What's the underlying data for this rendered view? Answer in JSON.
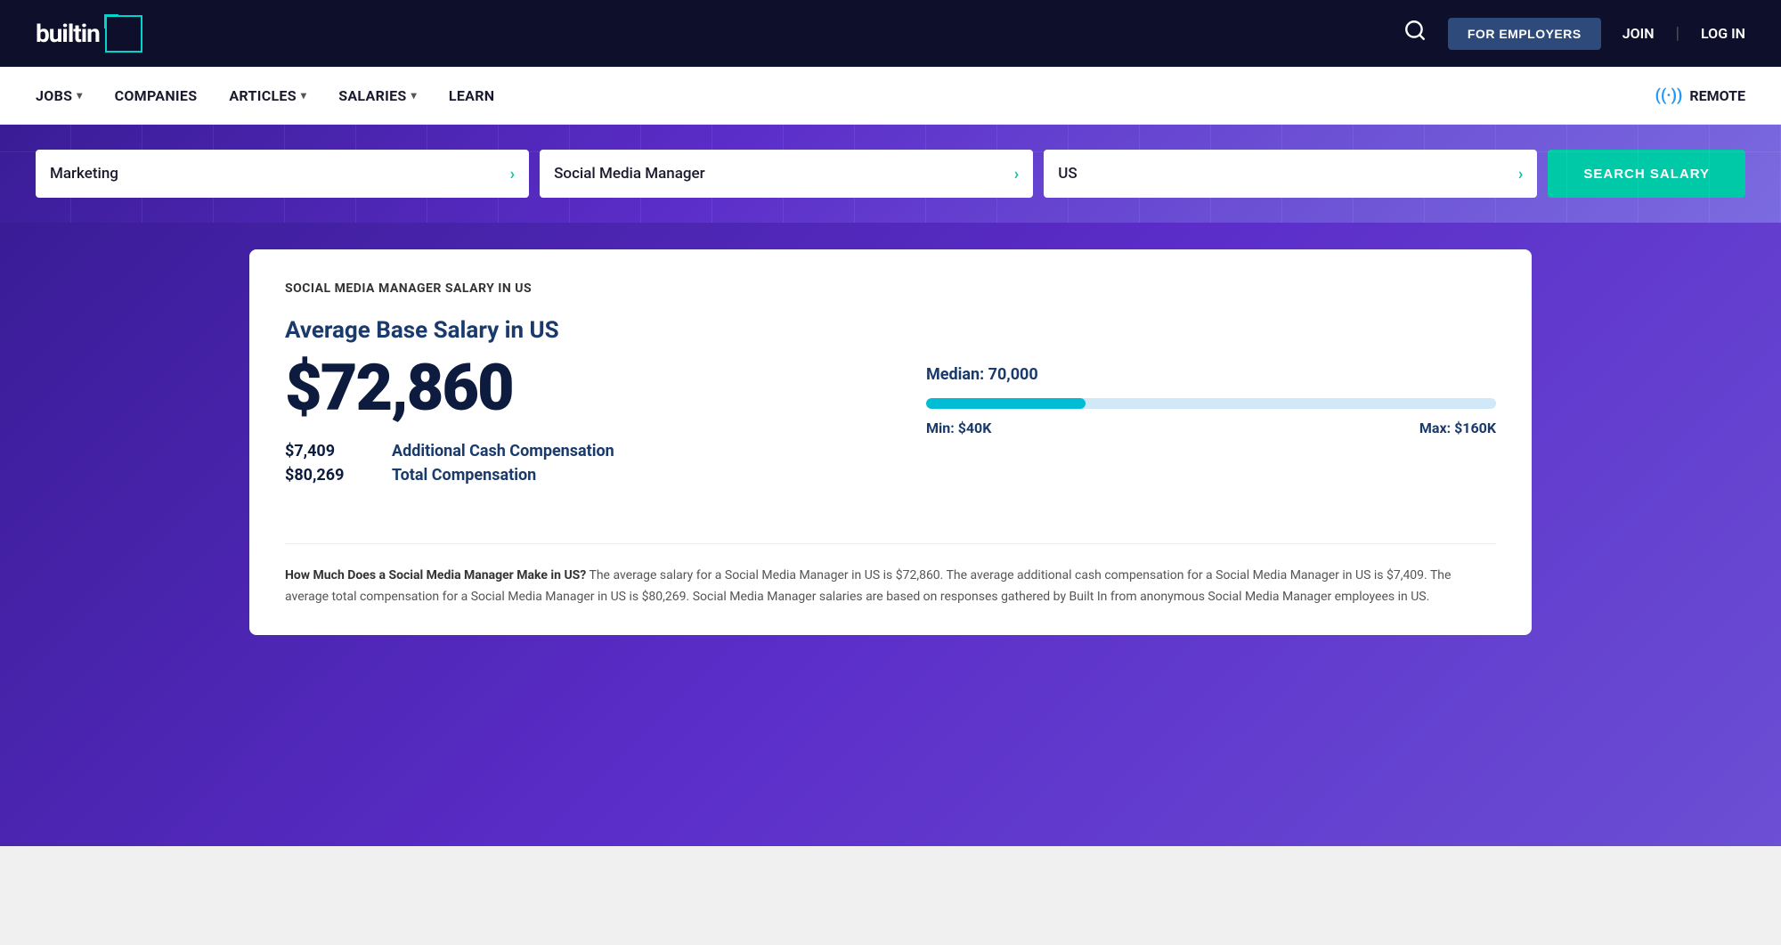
{
  "topNav": {
    "logo": "builtin",
    "forEmployers": "FOR EMPLOYERS",
    "join": "JOIN",
    "login": "LOG IN"
  },
  "secondaryNav": {
    "items": [
      {
        "id": "jobs",
        "label": "JOBS",
        "hasChevron": true
      },
      {
        "id": "companies",
        "label": "COMPANIES",
        "hasChevron": false
      },
      {
        "id": "articles",
        "label": "ARTICLES",
        "hasChevron": true
      },
      {
        "id": "salaries",
        "label": "SALARIES",
        "hasChevron": true
      },
      {
        "id": "learn",
        "label": "LEARN",
        "hasChevron": false
      }
    ],
    "remote": "REMOTE"
  },
  "searchArea": {
    "category": "Marketing",
    "jobTitle": "Social Media Manager",
    "location": "US",
    "buttonLabel": "SEARCH SALARY"
  },
  "salaryCard": {
    "pageTitle": "SOCIAL MEDIA MANAGER SALARY IN US",
    "averageTitle": "Average Base Salary in US",
    "baseSalary": "$72,860",
    "cashAmount": "$7,409",
    "cashLabel": "Additional Cash Compensation",
    "totalAmount": "$80,269",
    "totalLabel": "Total Compensation",
    "median": "Median: 70,000",
    "minLabel": "Min: $40K",
    "maxLabel": "Max: $160K",
    "barFillPercent": 28,
    "description": {
      "question": "How Much Does a Social Media Manager Make in US?",
      "body": " The average salary for a Social Media Manager in US is $72,860. The average additional cash compensation for a Social Media Manager in US is $7,409. The average total compensation for a Social Media Manager in US is $80,269. Social Media Manager salaries are based on responses gathered by Built In from anonymous Social Media Manager employees in US."
    }
  }
}
